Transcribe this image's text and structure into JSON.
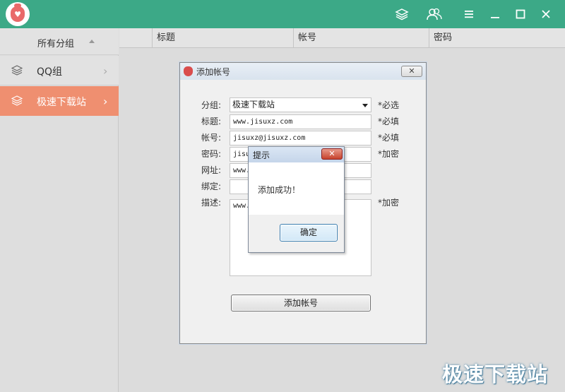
{
  "titlebar": {
    "icons": [
      "layers-icon",
      "users-icon",
      "menu-icon",
      "minimize-icon",
      "maximize-icon",
      "close-icon"
    ],
    "color": "#3ca987"
  },
  "sidebar": {
    "header": "所有分组",
    "items": [
      {
        "label": "QQ组",
        "icon": "layers-icon",
        "selected": false
      },
      {
        "label": "极速下载站",
        "icon": "layers-icon",
        "selected": true
      }
    ],
    "selected_color": "#ef8f70"
  },
  "table": {
    "columns": [
      "标题",
      "帐号",
      "密码"
    ]
  },
  "add_dialog": {
    "title": "添加帐号",
    "close_label": "✕",
    "fields": {
      "group": {
        "label": "分组:",
        "value": "极速下载站",
        "hint": "*必选"
      },
      "title": {
        "label": "标题:",
        "value": "www.jisuxz.com",
        "hint": "*必填"
      },
      "account": {
        "label": "帐号:",
        "value": "jisuxz@jisuxz.com",
        "hint": "*必填"
      },
      "password": {
        "label": "密码:",
        "value": "jisu",
        "hint": "*加密"
      },
      "url": {
        "label": "网址:",
        "value": "www."
      },
      "bind": {
        "label": "绑定:",
        "value": ""
      },
      "desc": {
        "label": "描述:",
        "value": "www.",
        "hint": "*加密"
      }
    },
    "submit_label": "添加帐号"
  },
  "message_box": {
    "title": "提示",
    "close_label": "✕",
    "message": "添加成功！",
    "ok_label": "确定"
  },
  "watermark": "极速下载站"
}
